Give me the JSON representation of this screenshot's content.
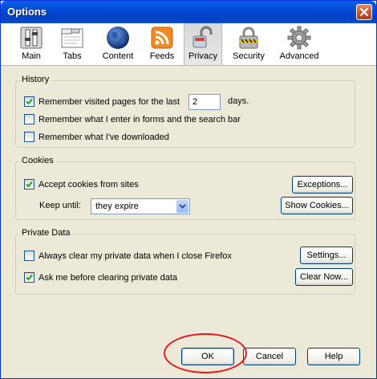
{
  "window": {
    "title": "Options"
  },
  "tabs": [
    {
      "label": "Main",
      "icon": "main-switch-icon"
    },
    {
      "label": "Tabs",
      "icon": "tabs-icon"
    },
    {
      "label": "Content",
      "icon": "globe-icon"
    },
    {
      "label": "Feeds",
      "icon": "rss-feed-icon"
    },
    {
      "label": "Privacy",
      "icon": "padlock-icon",
      "selected": true
    },
    {
      "label": "Security",
      "icon": "security-lock-icon"
    },
    {
      "label": "Advanced",
      "icon": "gear-icon"
    }
  ],
  "history": {
    "legend": "History",
    "remember_pages": {
      "label": "Remember visited pages for the last",
      "checked": true,
      "days_value": "2",
      "days_suffix": "days."
    },
    "remember_forms": {
      "label": "Remember what I enter in forms and the search bar",
      "checked": false
    },
    "remember_downloads": {
      "label": "Remember what I've downloaded",
      "checked": false
    }
  },
  "cookies": {
    "legend": "Cookies",
    "accept": {
      "label": "Accept cookies from sites",
      "checked": true
    },
    "exceptions_button": "Exceptions...",
    "keep_until_label": "Keep until:",
    "keep_until_value": "they expire",
    "show_cookies_button": "Show Cookies..."
  },
  "private_data": {
    "legend": "Private Data",
    "always_clear": {
      "label": "Always clear my private data when I close Firefox",
      "checked": false
    },
    "settings_button": "Settings...",
    "ask_before": {
      "label": "Ask me before clearing private data",
      "checked": true
    },
    "clear_now_button": "Clear Now..."
  },
  "footer": {
    "ok": "OK",
    "cancel": "Cancel",
    "help": "Help"
  },
  "colors": {
    "title_bar": "#0348d4",
    "dialog_bg": "#ece9d8",
    "annotation": "#e31b1b"
  }
}
